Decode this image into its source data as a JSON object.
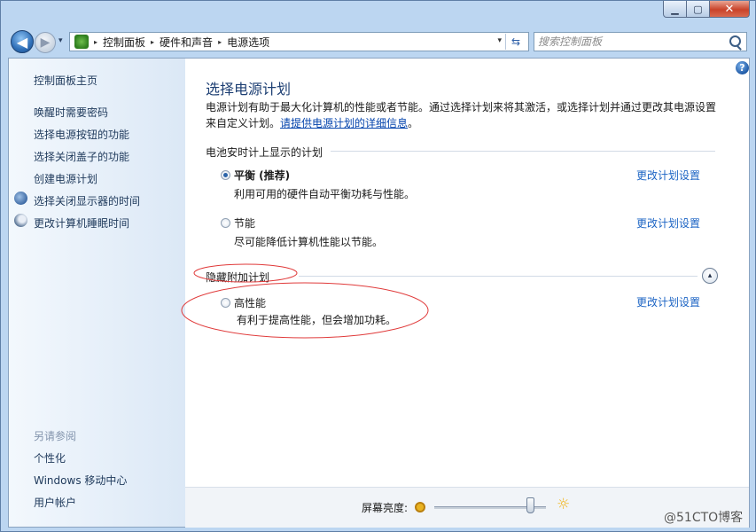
{
  "window": {
    "caption": {
      "min": "▁",
      "max": "▢",
      "close": "✕"
    }
  },
  "nav": {
    "back": "◀",
    "forward": "▶",
    "history": "▾",
    "breadcrumbs": [
      "控制面板",
      "硬件和声音",
      "电源选项"
    ],
    "crumb_sep": "▸",
    "address_dropdown": "▾",
    "refresh": "⇆",
    "search_placeholder": "搜索控制面板"
  },
  "sidebar": {
    "home": "控制面板主页",
    "links": [
      "唤醒时需要密码",
      "选择电源按钮的功能",
      "选择关闭盖子的功能",
      "创建电源计划",
      "选择关闭显示器的时间",
      "更改计算机睡眠时间"
    ],
    "see_also_header": "另请参阅",
    "see_also": [
      "个性化",
      "Windows 移动中心",
      "用户帐户"
    ]
  },
  "main": {
    "help": "?",
    "title": "选择电源计划",
    "description": "电源计划有助于最大化计算机的性能或者节能。通过选择计划来将其激活，或选择计划并通过更改其电源设置来自定义计划。",
    "description_link": "请提供电源计划的详细信息",
    "description_end": "。",
    "section_battery": "电池安时计上显示的计划",
    "section_hidden": "隐藏附加计划",
    "collapse": "▴",
    "plans": [
      {
        "name": "平衡 (推荐)",
        "desc": "利用可用的硬件自动平衡功耗与性能。",
        "link": "更改计划设置",
        "selected": true
      },
      {
        "name": "节能",
        "desc": "尽可能降低计算机性能以节能。",
        "link": "更改计划设置",
        "selected": false
      },
      {
        "name": "高性能",
        "desc": "有利于提高性能，但会增加功耗。",
        "link": "更改计划设置",
        "selected": false
      }
    ],
    "brightness_label": "屏幕亮度:",
    "brightness_level": 0.86,
    "sun": "☼"
  },
  "watermark": "@51CTO博客",
  "colors": {
    "annotation_red": "#e03a3a",
    "link": "#1c64c4",
    "title": "#1d3f73"
  }
}
